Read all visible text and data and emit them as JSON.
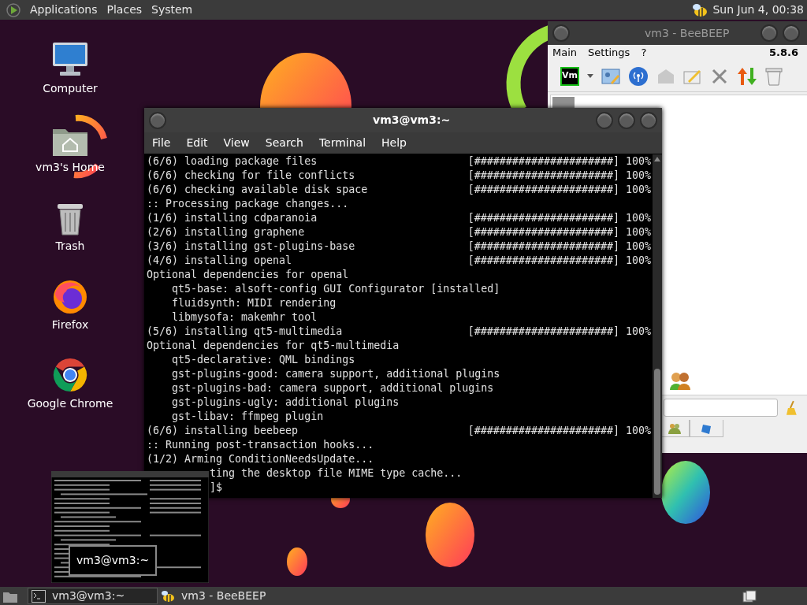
{
  "top_panel": {
    "menus": [
      "Applications",
      "Places",
      "System"
    ],
    "clock": "Sun Jun 4, 00:38"
  },
  "desktop_icons": [
    {
      "label": "Computer",
      "kind": "computer"
    },
    {
      "label": "vm3's Home",
      "kind": "home"
    },
    {
      "label": "Trash",
      "kind": "trash"
    },
    {
      "label": "Firefox",
      "kind": "firefox"
    },
    {
      "label": "Google Chrome",
      "kind": "chrome"
    }
  ],
  "beebeep": {
    "title": "vm3 - BeeBEEP",
    "menus": [
      "Main",
      "Settings",
      "?"
    ],
    "version": "5.8.6",
    "profile_badge": "Vm"
  },
  "terminal": {
    "title": "vm3@vm3:~",
    "menus": [
      "File",
      "Edit",
      "View",
      "Search",
      "Terminal",
      "Help"
    ],
    "lines": [
      {
        "kind": "line",
        "text": "(6/6) loading package files",
        "bar": "[######################] 100%"
      },
      {
        "kind": "line",
        "text": "(6/6) checking for file conflicts",
        "bar": "[######################] 100%"
      },
      {
        "kind": "line",
        "text": "(6/6) checking available disk space",
        "bar": "[######################] 100%"
      },
      {
        "kind": "line",
        "text": ":: Processing package changes..."
      },
      {
        "kind": "line",
        "text": "(1/6) installing cdparanoia",
        "bar": "[######################] 100%"
      },
      {
        "kind": "line",
        "text": "(2/6) installing graphene",
        "bar": "[######################] 100%"
      },
      {
        "kind": "line",
        "text": "(3/6) installing gst-plugins-base",
        "bar": "[######################] 100%"
      },
      {
        "kind": "line",
        "text": "(4/6) installing openal",
        "bar": "[######################] 100%"
      },
      {
        "kind": "line",
        "text": "Optional dependencies for openal"
      },
      {
        "kind": "dep",
        "text": "qt5-base: alsoft-config GUI Configurator [installed]"
      },
      {
        "kind": "dep",
        "text": "fluidsynth: MIDI rendering"
      },
      {
        "kind": "dep",
        "text": "libmysofa: makemhr tool"
      },
      {
        "kind": "line",
        "text": "(5/6) installing qt5-multimedia",
        "bar": "[######################] 100%"
      },
      {
        "kind": "line",
        "text": "Optional dependencies for qt5-multimedia"
      },
      {
        "kind": "dep",
        "text": "qt5-declarative: QML bindings"
      },
      {
        "kind": "dep",
        "text": "gst-plugins-good: camera support, additional plugins"
      },
      {
        "kind": "dep",
        "text": "gst-plugins-bad: camera support, additional plugins"
      },
      {
        "kind": "dep",
        "text": "gst-plugins-ugly: additional plugins"
      },
      {
        "kind": "dep",
        "text": "gst-libav: ffmpeg plugin"
      },
      {
        "kind": "line",
        "text": "(6/6) installing beebeep",
        "bar": "[######################] 100%"
      },
      {
        "kind": "line",
        "text": ":: Running post-transaction hooks..."
      },
      {
        "kind": "line",
        "text": "(1/2) Arming ConditionNeedsUpdate..."
      },
      {
        "kind": "covered",
        "text": "ting the desktop file MIME type cache..."
      },
      {
        "kind": "covered",
        "text": "]$"
      }
    ]
  },
  "preview": {
    "label": "vm3@vm3:~"
  },
  "taskbar": {
    "tasks": [
      {
        "label": "vm3@vm3:~",
        "kind": "terminal",
        "selected": true
      },
      {
        "label": "vm3 - BeeBEEP",
        "kind": "beebeep",
        "selected": false
      }
    ]
  }
}
